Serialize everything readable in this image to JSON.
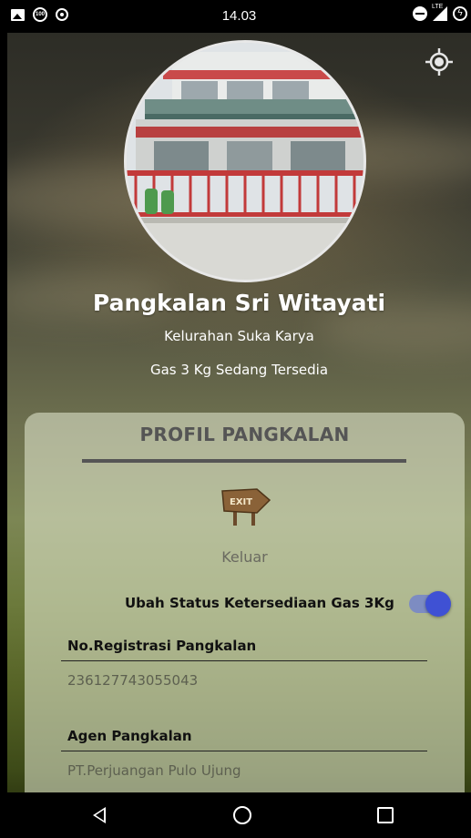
{
  "status_bar": {
    "time": "14.03",
    "network_label": "LTE",
    "notification_badge": "100"
  },
  "profile": {
    "name": "Pangkalan Sri Witayati",
    "kelurahan": "Kelurahan Suka Karya",
    "gas_status": "Gas 3 Kg Sedang Tersedia"
  },
  "card": {
    "title": "PROFIL PANGKALAN",
    "exit_sign_text": "EXIT",
    "exit_label": "Keluar",
    "toggle_label": "Ubah Status Ketersediaan Gas 3Kg",
    "toggle_on": true,
    "fields": [
      {
        "label": "No.Registrasi Pangkalan",
        "value": "236127743055043"
      },
      {
        "label": "Agen Pangkalan",
        "value": "PT.Perjuangan Pulo Ujung"
      }
    ]
  },
  "icons": {
    "locate": "crosshair-location-icon",
    "exit": "exit-sign-icon",
    "nav_back": "back-triangle-icon",
    "nav_home": "home-circle-icon",
    "nav_recent": "recent-apps-square-icon"
  },
  "colors": {
    "switch_knob": "#3f51d4",
    "switch_track": "#7d8cc2",
    "card_bg": "#e8ecd6"
  }
}
